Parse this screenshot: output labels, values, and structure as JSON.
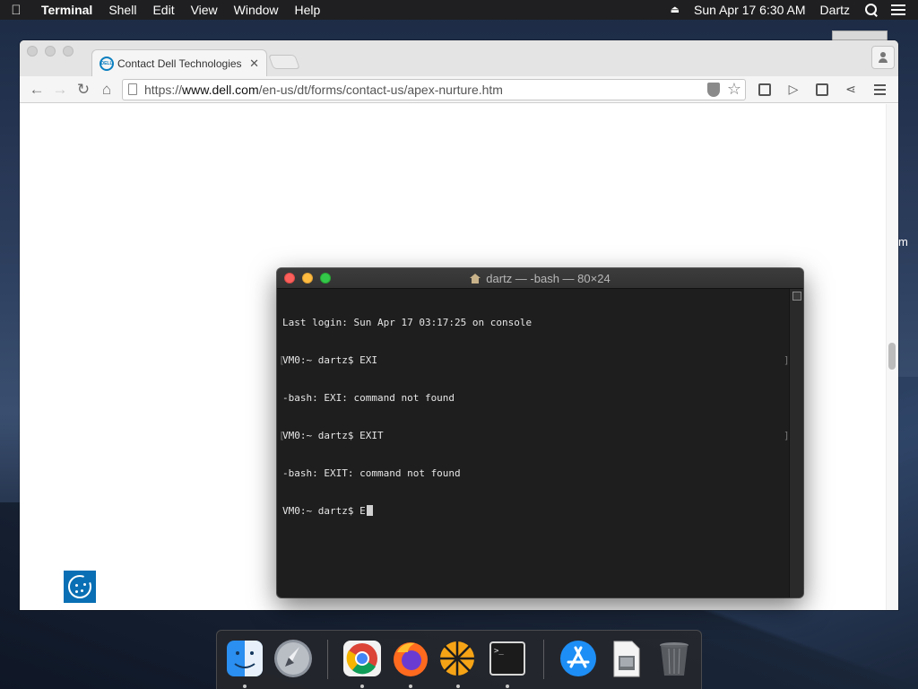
{
  "menubar": {
    "apple_icon": "apple-icon",
    "app_name": "Terminal",
    "menus": [
      "Shell",
      "Edit",
      "View",
      "Window",
      "Help"
    ],
    "datetime": "Sun Apr 17  6:30 AM",
    "user": "Dartz"
  },
  "browser": {
    "tab": {
      "favicon_text": "DELL",
      "title": "Contact Dell Technologies",
      "close_glyph": "✕"
    },
    "toolbar": {
      "back_glyph": "←",
      "forward_glyph": "→",
      "reload_glyph": "↻",
      "home_glyph": "⌂",
      "url_scheme": "https://",
      "url_host": "www.dell.com",
      "url_path": "/en-us/dt/forms/contact-us/apex-nurture.htm",
      "star_glyph": "☆",
      "play_glyph": "▷",
      "share_glyph": "⋖"
    },
    "side_peek_text": "m"
  },
  "terminal": {
    "title": "dartz — -bash — 80×24",
    "lines": [
      "Last login: Sun Apr 17 03:17:25 on console",
      "VM0:~ dartz$ EXI",
      "-bash: EXI: command not found",
      "VM0:~ dartz$ EXIT",
      "-bash: EXIT: command not found",
      "VM0:~ dartz$ E"
    ],
    "bracket_l": "[",
    "bracket_r": "]"
  },
  "dock": {
    "items": [
      "finder-icon",
      "launchpad-icon",
      "chrome-icon",
      "firefox-icon",
      "orange-app-icon",
      "terminal-icon",
      "app-store-icon",
      "preview-icon",
      "trash-icon"
    ],
    "terminal_prompt": ">_"
  },
  "colors": {
    "dell_blue": "#0a6fb4",
    "terminal_bg": "#1e1e1e",
    "menubar_bg": "#1f1f21"
  }
}
